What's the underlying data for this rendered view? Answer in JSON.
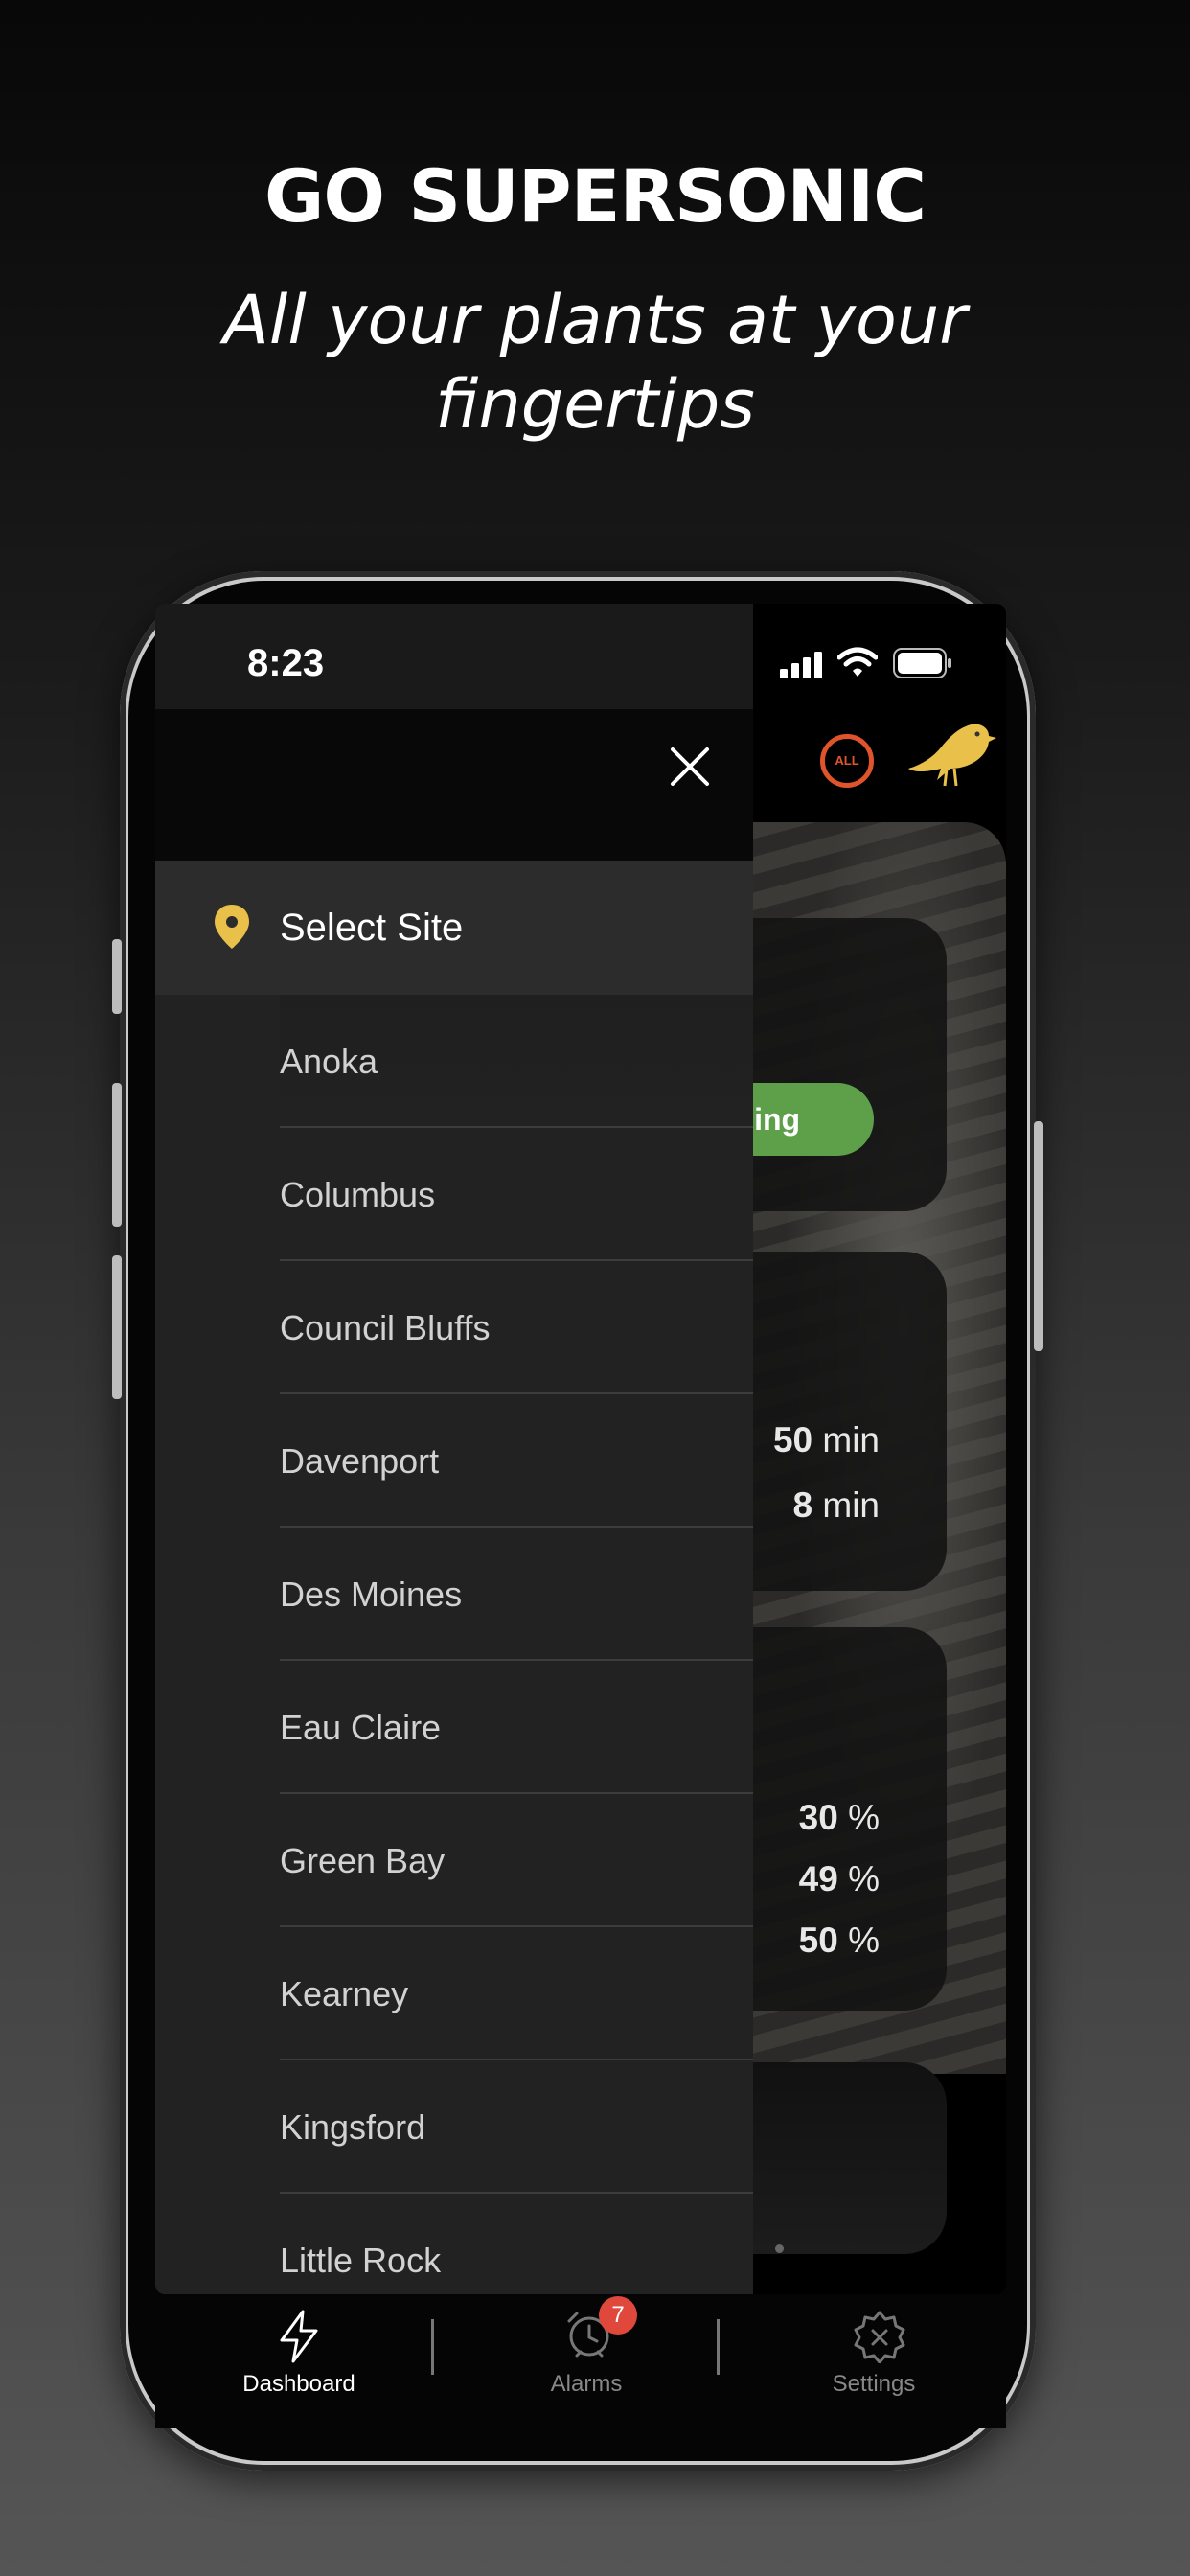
{
  "promo": {
    "headline": "GO SUPERSONIC",
    "subline": "All your plants at your fingertips"
  },
  "status_bar": {
    "time": "8:23"
  },
  "header": {
    "all_label": "ALL"
  },
  "drawer": {
    "select_label": "Select Site",
    "sites": [
      "Anoka",
      "Columbus",
      "Council Bluffs",
      "Davenport",
      "Des Moines",
      "Eau Claire",
      "Green Bay",
      "Kearney",
      "Kingsford",
      "Little Rock"
    ]
  },
  "background": {
    "status": "Running",
    "status_visible": "nning",
    "times": [
      {
        "value": "50",
        "unit": "min"
      },
      {
        "value": "8",
        "unit": "min"
      }
    ],
    "percentages": [
      {
        "value": "30",
        "unit": "%"
      },
      {
        "value": "49",
        "unit": "%"
      },
      {
        "value": "50",
        "unit": "%"
      }
    ]
  },
  "tabs": [
    {
      "label": "Dashboard",
      "icon": "bolt-icon",
      "active": true
    },
    {
      "label": "Alarms",
      "icon": "alarm-clock-icon",
      "active": false,
      "badge": "7"
    },
    {
      "label": "Settings",
      "icon": "gear-icon",
      "active": false
    }
  ],
  "colors": {
    "accent_gold": "#e8c04a",
    "running_green": "#5ea04a",
    "alarm_red": "#e0483b",
    "all_orange": "#e0542c"
  }
}
